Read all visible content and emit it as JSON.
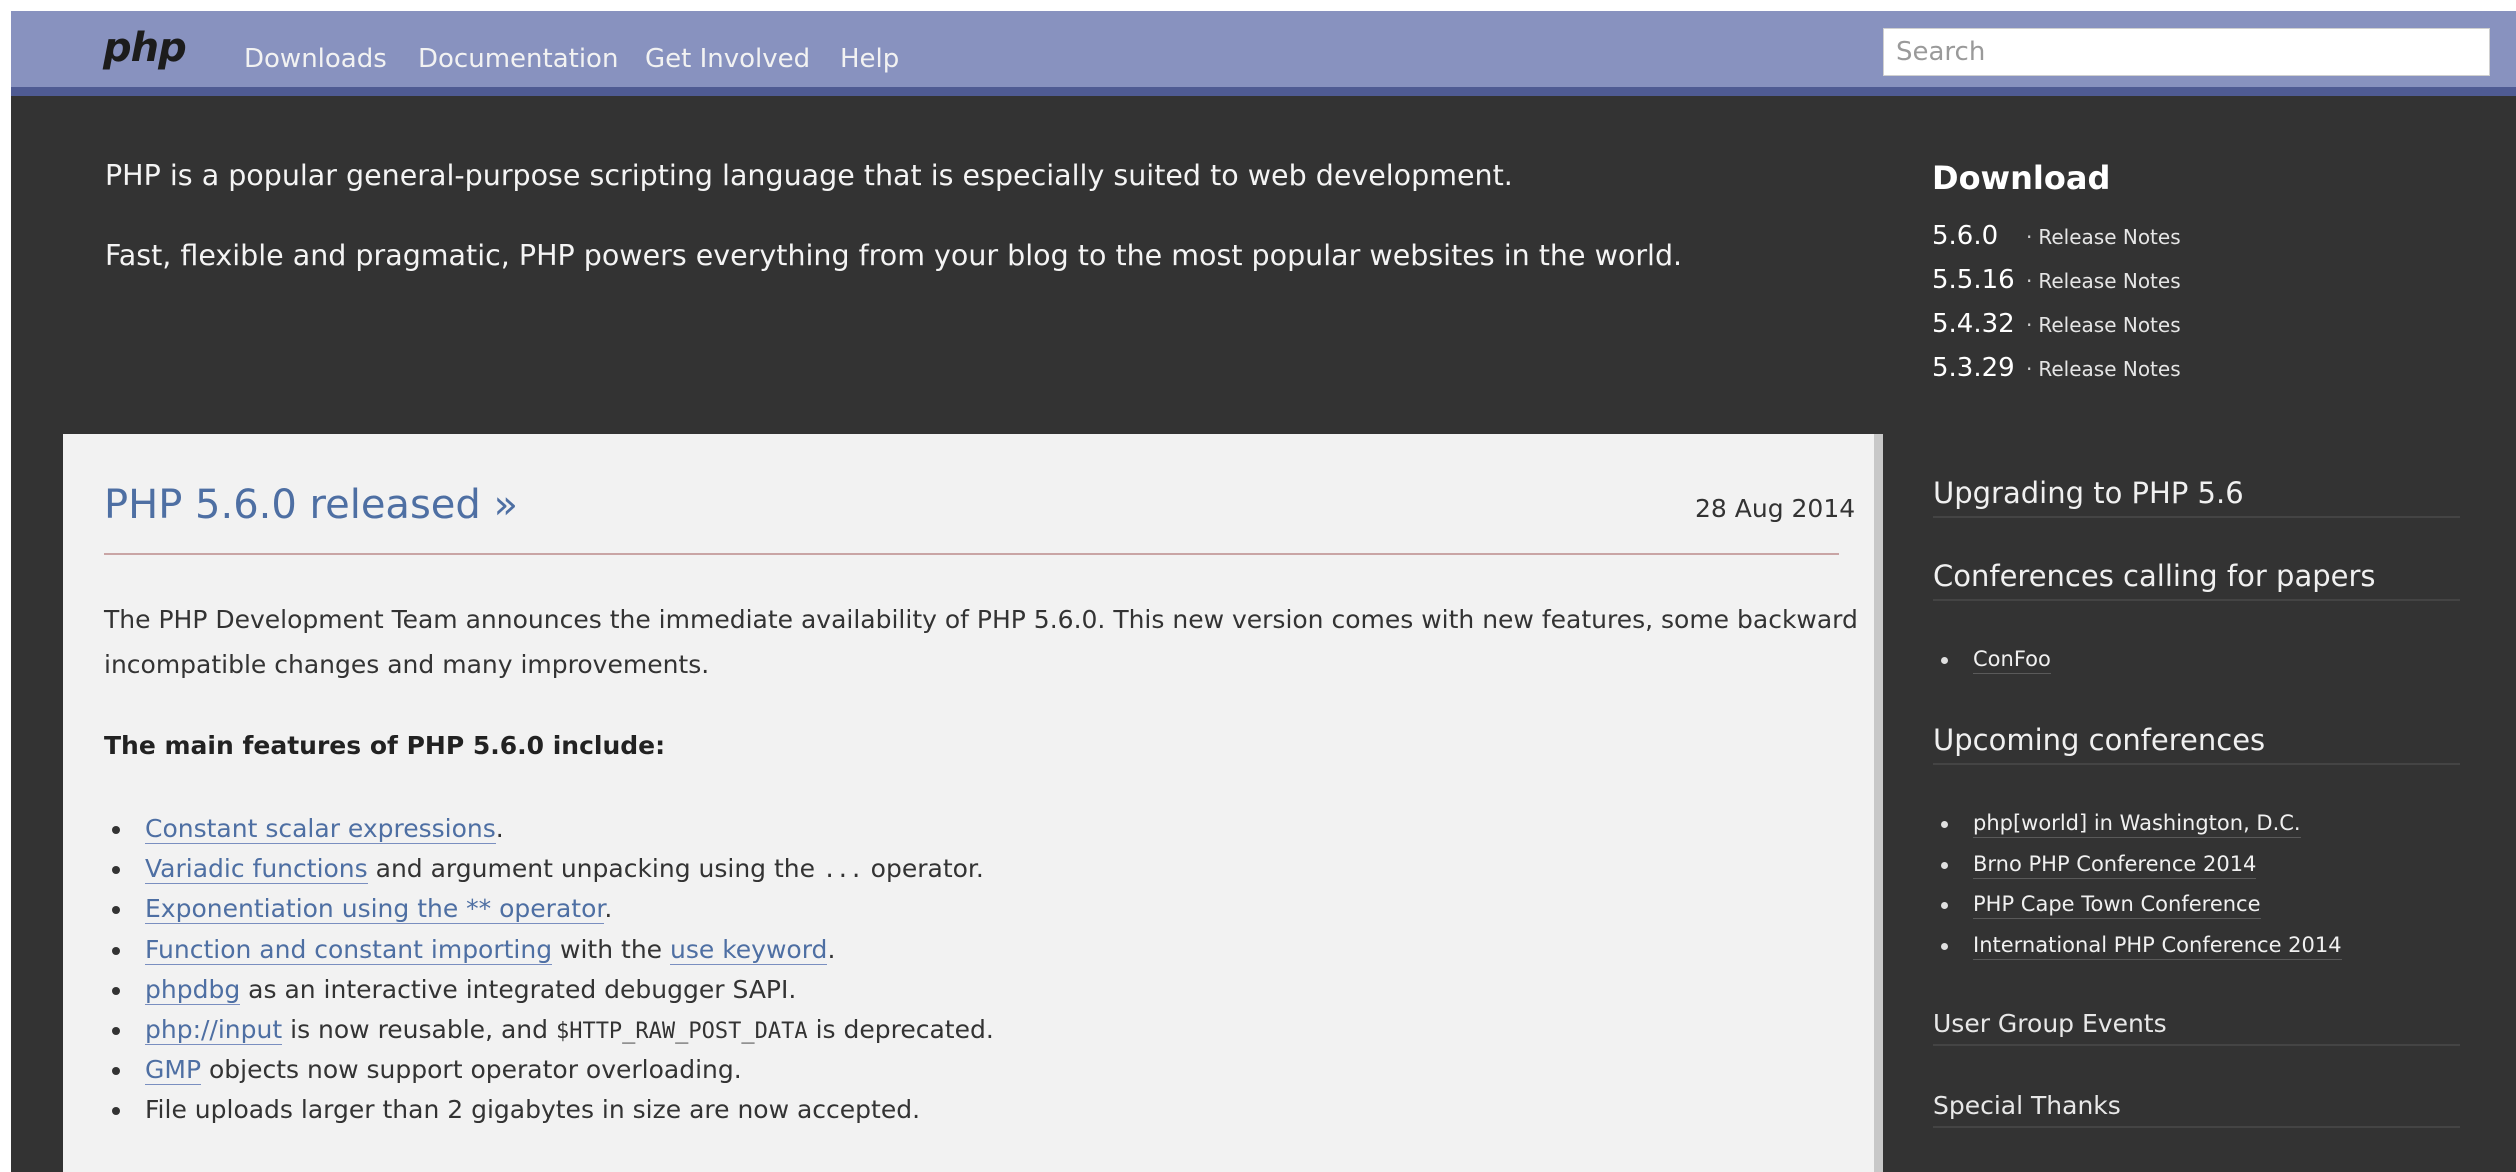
{
  "nav": {
    "logo": "php",
    "links": [
      "Downloads",
      "Documentation",
      "Get Involved",
      "Help"
    ],
    "search_placeholder": "Search"
  },
  "intro": {
    "line1": "PHP is a popular general-purpose scripting language that is especially suited to web development.",
    "line2": "Fast, flexible and pragmatic, PHP powers everything from your blog to the most popular websites in the world."
  },
  "news": {
    "title": "PHP 5.6.0 released »",
    "date": "28 Aug 2014",
    "paragraph_line1": "The PHP Development Team announces the immediate availability of PHP 5.6.0. This new version comes with new features, some backward",
    "paragraph_line2": "incompatible changes and many improvements.",
    "features_heading": "The main features of PHP 5.6.0 include:",
    "features": [
      {
        "link": "Constant scalar expressions",
        "rest": "."
      },
      {
        "link": "Variadic functions",
        "rest_a": " and argument unpacking using the ",
        "code": "...",
        "rest_b": " operator."
      },
      {
        "link": "Exponentiation using the ** operator",
        "rest": "."
      },
      {
        "link": "Function and constant importing",
        "rest_a": " with the ",
        "link2": "use keyword",
        "rest_b": "."
      },
      {
        "link": "phpdbg",
        "rest": " as an interactive integrated debugger SAPI."
      },
      {
        "link": "php://input",
        "rest_a": " is now reusable, and ",
        "code": "$HTTP_RAW_POST_DATA",
        "rest_b": " is deprecated."
      },
      {
        "link": "GMP",
        "rest": " objects now support operator overloading."
      },
      {
        "text": "File uploads larger than 2 gigabytes in size are now accepted."
      }
    ]
  },
  "sidebar": {
    "download_heading": "Download",
    "downloads": [
      {
        "version": "5.6.0",
        "separator": "·",
        "notes": "Release Notes"
      },
      {
        "version": "5.5.16",
        "separator": "·",
        "notes": "Release Notes"
      },
      {
        "version": "5.4.32",
        "separator": "·",
        "notes": "Release Notes"
      },
      {
        "version": "5.3.29",
        "separator": "·",
        "notes": "Release Notes"
      }
    ],
    "upgrading": "Upgrading to PHP 5.6",
    "cfp_heading": "Conferences calling for papers",
    "cfp_items": [
      "ConFoo"
    ],
    "upcoming_heading": "Upcoming conferences",
    "upcoming_items": [
      "php[world] in Washington, D.C.",
      "Brno PHP Conference 2014",
      "PHP Cape Town Conference",
      "International PHP Conference 2014"
    ],
    "user_group_events": "User Group Events",
    "special_thanks": "Special Thanks"
  }
}
